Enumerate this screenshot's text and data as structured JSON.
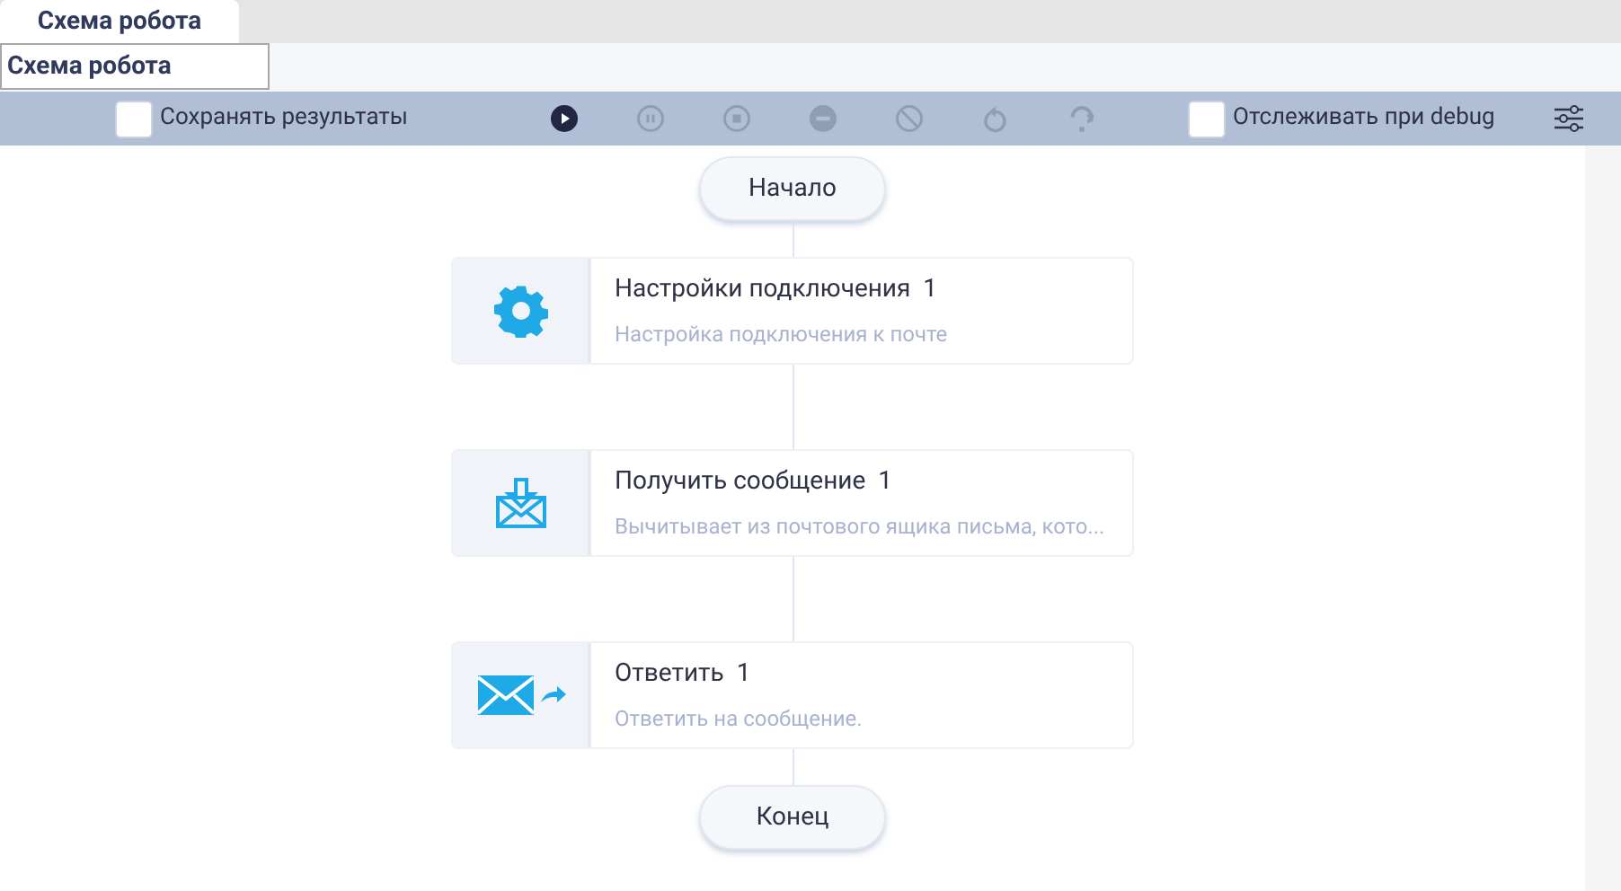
{
  "tabs": [
    {
      "label": "Схема робота",
      "selected": true
    }
  ],
  "name_field": {
    "value": "Схема робота"
  },
  "toolbar": {
    "save_results": {
      "label": "Сохранять результаты",
      "checked": false
    },
    "controls": [
      {
        "kind": "play",
        "disabled": false
      },
      {
        "kind": "pause",
        "disabled": true
      },
      {
        "kind": "stop",
        "disabled": true
      },
      {
        "kind": "minus",
        "disabled": true
      },
      {
        "kind": "block",
        "disabled": true
      },
      {
        "kind": "undo",
        "disabled": true
      },
      {
        "kind": "redo",
        "disabled": true
      }
    ],
    "debug_trace": {
      "label": "Отслеживать при debug",
      "checked": false
    }
  },
  "flow": [
    {
      "kind": "terminal",
      "label": "Начало"
    },
    {
      "kind": "step",
      "title": "Настройки подключения",
      "count": "1",
      "description": "Настройка подключения к почте"
    },
    {
      "kind": "step",
      "title": "Получить сообщение",
      "count": "1",
      "description": "Вычитывает из почтового ящика письма, кото..."
    },
    {
      "kind": "step",
      "title": "Ответить",
      "count": "1",
      "description": "Ответить на сообщение."
    },
    {
      "kind": "terminal",
      "label": "Конец"
    }
  ]
}
